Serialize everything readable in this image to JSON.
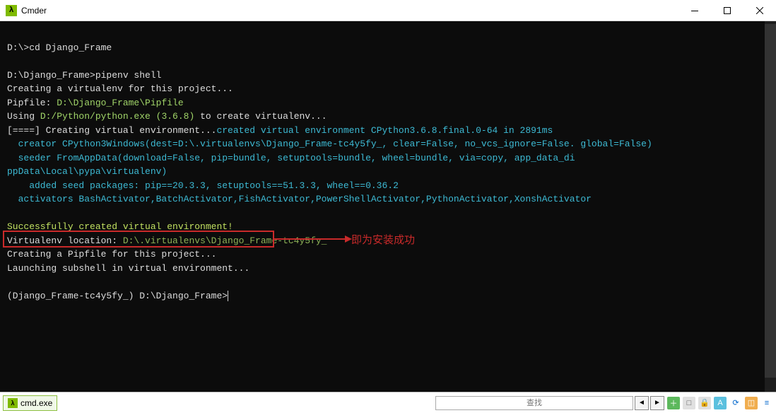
{
  "window": {
    "title": "Cmder",
    "icon_glyph": "λ"
  },
  "terminal": {
    "line1_prompt": "D:\\>",
    "line1_cmd": "cd Django_Frame",
    "line2_prompt": "D:\\Django_Frame>",
    "line2_cmd": "pipenv shell",
    "creating": "Creating a virtualenv for this project...",
    "pipfile_label": "Pipfile: ",
    "pipfile_path": "D:\\Django_Frame\\Pipfile",
    "using1": "Using ",
    "using_path": "D:/Python/python.exe",
    "using_ver": " (3.6.8)",
    "using2": " to create virtualenv...",
    "progress": "[====] ",
    "creating_env": "Creating virtual environment...",
    "created_msg": "created virtual environment CPython3.6.8.final.0-64 in 2891ms",
    "creator": "  creator CPython3Windows(dest=D:\\.virtualenvs\\Django_Frame-tc4y5fy_, clear=False, no_vcs_ignore=False. global=False)",
    "seeder": "  seeder FromAppData(download=False, pip=bundle, setuptools=bundle, wheel=bundle, via=copy, app_data_di",
    "ppdata": "ppData\\Local\\pypa\\virtualenv)",
    "added_seed": "    added seed packages: pip==20.3.3, setuptools==51.3.3, wheel==0.36.2",
    "activators": "  activators BashActivator,BatchActivator,FishActivator,PowerShellActivator,PythonActivator,XonshActivator",
    "success": "Successfully created virtual environment!",
    "venv_loc_label": "Virtualenv location: ",
    "venv_loc_path": "D:\\.virtualenvs\\Django_Frame-tc4y5fy_",
    "creating_pipfile": "Creating a Pipfile for this project...",
    "launching": "Launching subshell in virtual environment...",
    "final_prompt": "(Django_Frame-tc4y5fy_) D:\\Django_Frame>"
  },
  "annotation": "即为安装成功",
  "status": {
    "tab_label": "cmd.exe",
    "find_placeholder": "查找"
  }
}
